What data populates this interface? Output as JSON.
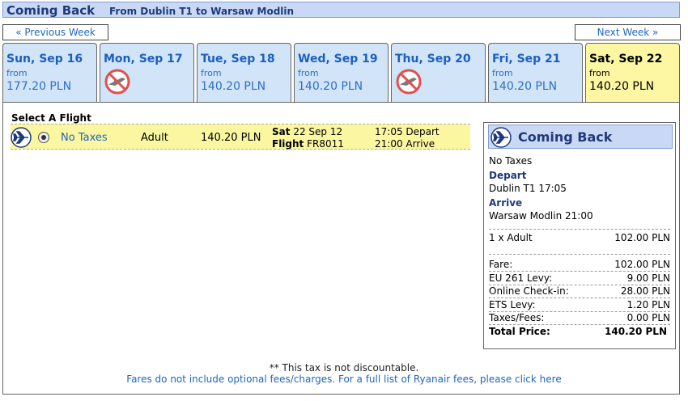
{
  "header": {
    "title": "Coming Back",
    "route": "From Dublin T1 to Warsaw Modlin"
  },
  "nav": {
    "prev": "« Previous Week",
    "next": "Next Week »"
  },
  "tabs": [
    {
      "day": "Sun, Sep 16",
      "from": "from",
      "price": "177.20 PLN",
      "available": true,
      "selected": false
    },
    {
      "day": "Mon, Sep 17",
      "from": "",
      "price": "",
      "available": false,
      "selected": false
    },
    {
      "day": "Tue, Sep 18",
      "from": "from",
      "price": "140.20 PLN",
      "available": true,
      "selected": false
    },
    {
      "day": "Wed, Sep 19",
      "from": "from",
      "price": "140.20 PLN",
      "available": true,
      "selected": false
    },
    {
      "day": "Thu, Sep 20",
      "from": "",
      "price": "",
      "available": false,
      "selected": false
    },
    {
      "day": "Fri, Sep 21",
      "from": "from",
      "price": "140.20 PLN",
      "available": true,
      "selected": false
    },
    {
      "day": "Sat, Sep 22",
      "from": "from",
      "price": "140.20 PLN",
      "available": true,
      "selected": true
    }
  ],
  "flight": {
    "section_label": "Select A Flight",
    "fare_type": "No Taxes",
    "passenger": "Adult",
    "price": "140.20 PLN",
    "day_label": "Sat",
    "date": "22 Sep 12",
    "flight_label": "Flight",
    "flight_no": "FR8011",
    "depart_time": "17:05 Depart",
    "arrive_time": "21:00 Arrive",
    "selected": true
  },
  "summary": {
    "title": "Coming Back",
    "fare_type": "No Taxes",
    "depart_label": "Depart",
    "depart_value": "Dublin T1 17:05",
    "arrive_label": "Arrive",
    "arrive_value": "Warsaw Modlin 21:00",
    "pax_label": "1 x Adult",
    "pax_value": "102.00 PLN",
    "lines": [
      {
        "label": "Fare:",
        "value": "102.00 PLN"
      },
      {
        "label": "EU 261 Levy:",
        "value": "9.00 PLN"
      },
      {
        "label": "Online Check-in:",
        "value": "28.00 PLN"
      },
      {
        "label": "ETS Levy:",
        "value": "1.20 PLN"
      },
      {
        "label": "Taxes/Fees:",
        "value": "0.00 PLN"
      }
    ],
    "total_label": "Total Price:",
    "total_value": "140.20 PLN"
  },
  "footer": {
    "note": "** This tax is not discountable.",
    "link": "Fares do not include optional fees/charges. For a full list of Ryanair fees, please click here"
  },
  "colors": {
    "accent": "#1f3a7a",
    "tab": "#d2e4f8",
    "selected": "#fdf7a4",
    "link": "#2266bb",
    "noflight": "#e05050"
  }
}
